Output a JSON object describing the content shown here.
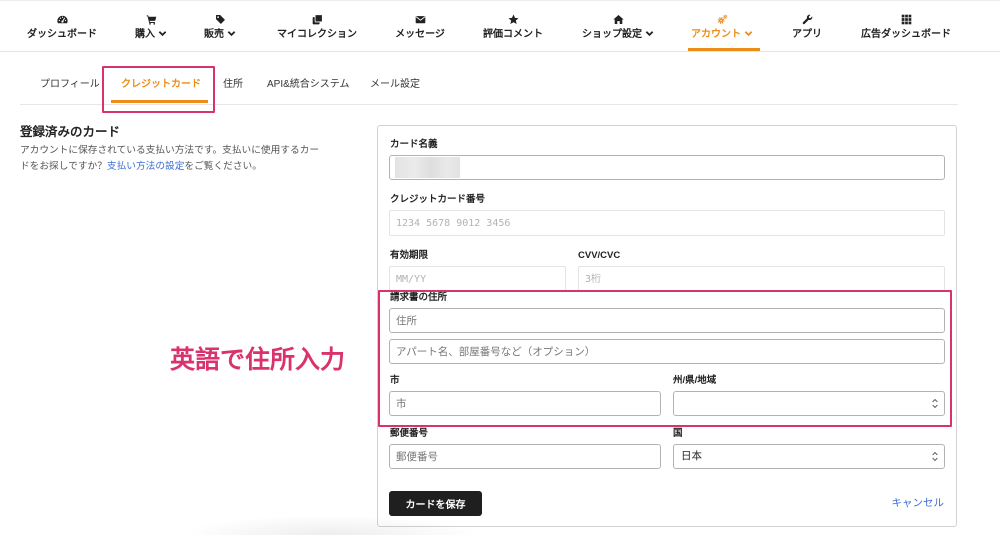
{
  "colors": {
    "accent": "#ec8d17",
    "annotation": "#d9336e",
    "link": "#3a6fd1",
    "button": "#1f1f1f"
  },
  "nav": {
    "items": [
      {
        "label": "ダッシュボード",
        "icon": "dashboard-icon"
      },
      {
        "label": "購入",
        "icon": "cart-icon",
        "dropdown": true
      },
      {
        "label": "販売",
        "icon": "tag-icon",
        "dropdown": true
      },
      {
        "label": "マイコレクション",
        "icon": "collection-icon"
      },
      {
        "label": "メッセージ",
        "icon": "envelope-icon"
      },
      {
        "label": "評価コメント",
        "icon": "star-icon"
      },
      {
        "label": "ショップ設定",
        "icon": "home-icon",
        "dropdown": true
      },
      {
        "label": "アカウント",
        "icon": "gears-icon",
        "dropdown": true,
        "active": true
      },
      {
        "label": "アプリ",
        "icon": "wrench-icon"
      },
      {
        "label": "広告ダッシュボード",
        "icon": "grid-icon"
      }
    ]
  },
  "tabs": [
    {
      "label": "プロフィール"
    },
    {
      "label": "クレジットカード",
      "active": true
    },
    {
      "label": "住所"
    },
    {
      "label": "API&統合システム"
    },
    {
      "label": "メール設定"
    }
  ],
  "section": {
    "title": "登録済みのカード",
    "description": "アカウントに保存されている支払い方法です。支払いに使用するカードをお探しですか？",
    "link_text": "支払い方法の設定",
    "description_suffix": "をご覧ください。"
  },
  "form": {
    "card_name": {
      "label": "カード名義"
    },
    "card_number": {
      "label": "クレジットカード番号",
      "placeholder": "1234 5678 9012 3456"
    },
    "expiry": {
      "label": "有効期限",
      "placeholder": "MM/YY"
    },
    "cvv": {
      "label": "CVV/CVC",
      "placeholder": "3桁"
    },
    "billing_address": {
      "label": "請求書の住所",
      "line1_placeholder": "住所",
      "line2_placeholder": "アパート名、部屋番号など（オプション）"
    },
    "city": {
      "label": "市",
      "placeholder": "市"
    },
    "state": {
      "label": "州/県/地域"
    },
    "postal_code": {
      "label": "郵便番号",
      "placeholder": "郵便番号"
    },
    "country": {
      "label": "国",
      "value": "日本"
    },
    "save_button": "カードを保存",
    "cancel_link": "キャンセル"
  },
  "annotation": {
    "text": "英語で住所入力"
  }
}
